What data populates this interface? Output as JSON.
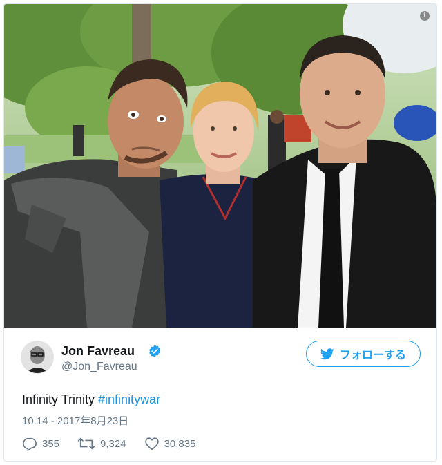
{
  "tweet": {
    "display_name": "Jon Favreau",
    "handle": "@Jon_Favreau",
    "verified": true,
    "text_plain": "Infinity Trinity ",
    "hashtag": "#infinitywar",
    "timestamp": "10:14 - 2017年8月23日",
    "photo_alt": "photo of three people posing in a park"
  },
  "follow_button": {
    "label": "フォローする",
    "icon": "twitter-bird-icon"
  },
  "actions": {
    "replies": "355",
    "retweets": "9,324",
    "likes": "30,835",
    "reply_icon": "reply-icon",
    "retweet_icon": "retweet-icon",
    "like_icon": "heart-icon"
  },
  "colors": {
    "accent": "#1da1f2",
    "hashtag": "#1b95e0",
    "muted": "#657786",
    "text": "#14171a",
    "border": "#e1e8ed"
  },
  "info_icon": "i"
}
